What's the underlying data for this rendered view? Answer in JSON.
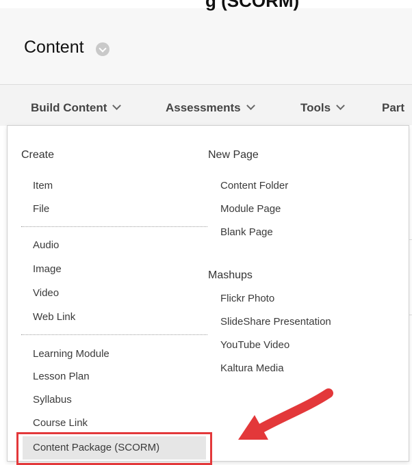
{
  "header": {
    "partial_title": "g (SCORM)",
    "page_title": "Content"
  },
  "toolbar": {
    "items": [
      {
        "label": "Build Content"
      },
      {
        "label": "Assessments"
      },
      {
        "label": "Tools"
      },
      {
        "label": "Part"
      }
    ]
  },
  "menu": {
    "create": {
      "heading": "Create",
      "group1": [
        "Item",
        "File"
      ],
      "group2": [
        "Audio",
        "Image",
        "Video",
        "Web Link"
      ],
      "group3": [
        "Learning Module",
        "Lesson Plan",
        "Syllabus",
        "Course Link",
        "Content Package (SCORM)"
      ]
    },
    "new_page": {
      "heading": "New Page",
      "items": [
        "Content Folder",
        "Module Page",
        "Blank Page"
      ]
    },
    "mashups": {
      "heading": "Mashups",
      "items": [
        "Flickr Photo",
        "SlideShare Presentation",
        "YouTube Video",
        "Kaltura Media"
      ]
    }
  },
  "annotation": {
    "highlight_color": "#e3383a",
    "arrow_color": "#e3383a"
  }
}
